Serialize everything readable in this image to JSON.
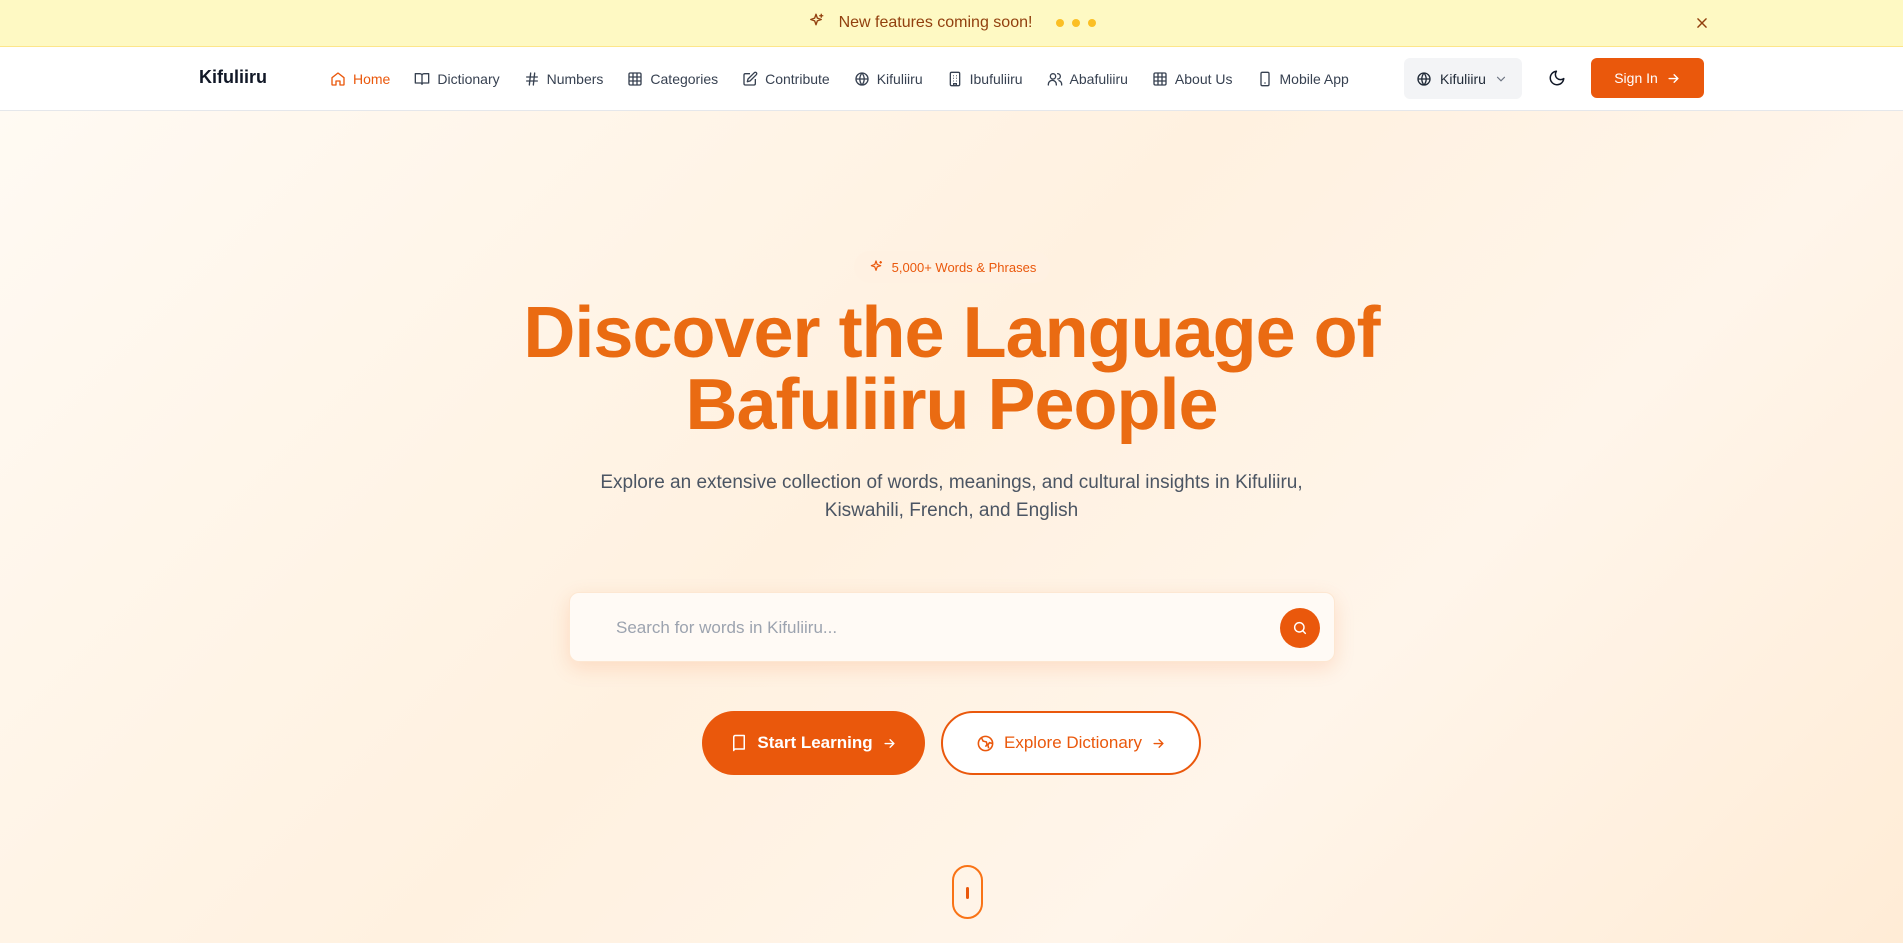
{
  "banner": {
    "text": "New features coming soon!"
  },
  "nav": {
    "brand": "Kifuliiru",
    "items": [
      {
        "label": "Home",
        "icon": "home-icon",
        "active": true
      },
      {
        "label": "Dictionary",
        "icon": "book-open-icon"
      },
      {
        "label": "Numbers",
        "icon": "hash-icon"
      },
      {
        "label": "Categories",
        "icon": "grid-icon"
      },
      {
        "label": "Contribute",
        "icon": "edit-icon"
      },
      {
        "label": "Kifuliiru",
        "icon": "globe-icon"
      },
      {
        "label": "Ibufuliiru",
        "icon": "building-icon"
      },
      {
        "label": "Abafuliiru",
        "icon": "users-icon"
      },
      {
        "label": "About Us",
        "icon": "table-icon"
      },
      {
        "label": "Mobile App",
        "icon": "smartphone-icon"
      }
    ],
    "language": "Kifuliiru",
    "sign_in": "Sign In"
  },
  "hero": {
    "badge": "5,000+ Words & Phrases",
    "title_line1": "Discover the Language of",
    "title_line2": "Bafuliiru People",
    "subtitle": "Explore an extensive collection of words, meanings, and cultural insights in Kifuliiru, Kiswahili, French, and English",
    "search_placeholder": "Search for words in Kifuliiru...",
    "start_learning": "Start Learning",
    "explore_dictionary": "Explore Dictionary"
  },
  "colors": {
    "accent": "#ea580c",
    "banner_bg": "#fef9c3"
  }
}
